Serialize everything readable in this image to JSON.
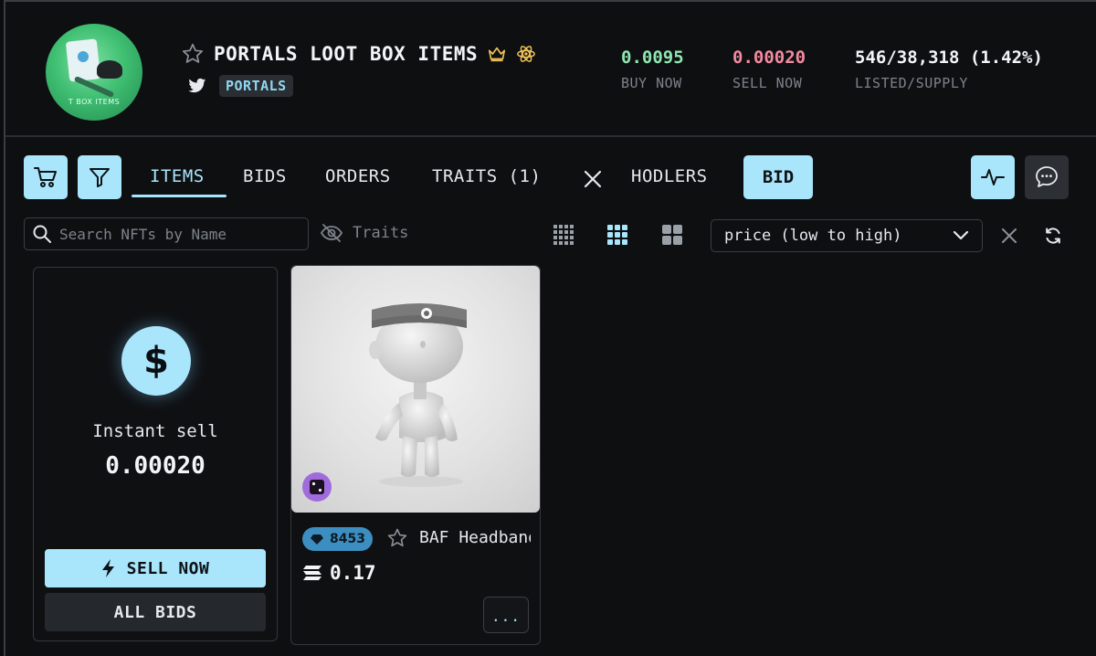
{
  "collection": {
    "title": "PORTALS LOOT BOX ITEMS",
    "tag": "PORTALS",
    "avatar_text": "T BOX ITEMS"
  },
  "stats": [
    {
      "value": "0.0095",
      "label": "BUY NOW",
      "color": "#8ee6b1"
    },
    {
      "value": "0.00020",
      "label": "SELL NOW",
      "color": "#f28aa0"
    },
    {
      "value": "546/38,318 (1.42%)",
      "label": "LISTED/SUPPLY",
      "color": "#f2f4f7"
    }
  ],
  "tabs": {
    "items": "ITEMS",
    "bids": "BIDS",
    "orders": "ORDERS",
    "traits": "TRAITS (1)",
    "hodlers": "HODLERS",
    "bid_button": "BID"
  },
  "search": {
    "placeholder": "Search NFTs by Name",
    "traits_label": "Traits"
  },
  "sort": {
    "selected": "price (low to high)"
  },
  "sell_card": {
    "label": "Instant sell",
    "value": "0.00020",
    "sell_now": "SELL NOW",
    "all_bids": "ALL BIDS"
  },
  "nft": {
    "rank": "8453",
    "name": "BAF Headband",
    "price": "0.17",
    "more": "..."
  },
  "colors": {
    "accent": "#a9e5fb",
    "buy": "#8ee6b1",
    "sell": "#f28aa0",
    "background": "#0e0f11"
  },
  "icons": [
    "star-icon",
    "crown-icon",
    "atom-icon",
    "twitter-icon",
    "cart-icon",
    "filter-icon",
    "close-icon",
    "activity-icon",
    "chat-icon",
    "search-icon",
    "eye-off-icon",
    "grid-small-icon",
    "grid-medium-icon",
    "grid-large-icon",
    "chevron-down-icon",
    "refresh-icon",
    "dollar-icon",
    "bolt-icon",
    "dice-icon",
    "diamond-icon",
    "solana-icon"
  ]
}
